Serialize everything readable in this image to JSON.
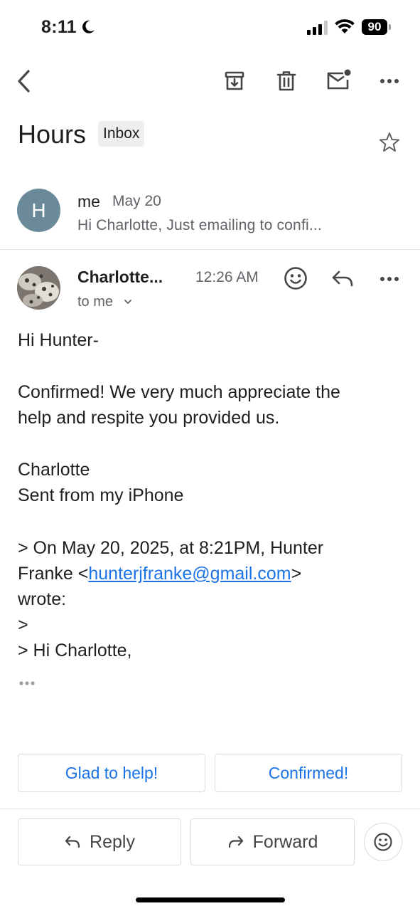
{
  "status": {
    "time": "8:11",
    "battery": "90"
  },
  "toolbar": {
    "icons": [
      "back-arrow-icon",
      "archive-icon",
      "delete-icon",
      "mark-unread-icon",
      "more-icon"
    ]
  },
  "subject": {
    "title": "Hours",
    "label": "Inbox"
  },
  "thread": {
    "collapsed": {
      "avatar_letter": "H",
      "avatar_color": "#6a8a99",
      "sender": "me",
      "date": "May 20",
      "snippet": "Hi Charlotte, Just emailing to confi..."
    },
    "message": {
      "sender": "Charlotte...",
      "time": "12:26 AM",
      "to": "to me",
      "body": {
        "greeting": "Hi Hunter-",
        "line1": "Confirmed! We very much appreciate the",
        "line2": "help and respite you provided us.",
        "signoff": "Charlotte",
        "signature": "Sent from my iPhone",
        "quote_line1": "> On May 20, 2025, at 8:21PM, Hunter",
        "quote_name_prefix": "Franke <",
        "quote_email": "hunterjfranke@gmail.com",
        "quote_name_suffix": ">",
        "quote_wrote": "wrote:",
        "quote_blank": ">",
        "quote_greeting": "> Hi Charlotte,"
      }
    }
  },
  "smart_replies": [
    "Glad to help!",
    "Confirmed!"
  ],
  "actions": {
    "reply": "Reply",
    "forward": "Forward"
  },
  "colors": {
    "accent": "#1a73e8",
    "muted": "#5f6368",
    "border": "#dadce0"
  }
}
